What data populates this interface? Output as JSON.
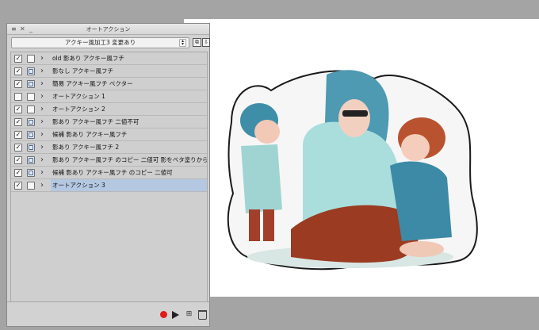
{
  "panel": {
    "title": "オートアクション",
    "set_name": "アクキー風加工3 変更あり",
    "items": [
      {
        "label": "old 影あり アクキー風フチ",
        "enabled": true,
        "dialog": false
      },
      {
        "label": "影なし アクキー風フチ",
        "enabled": true,
        "dialog": true
      },
      {
        "label": "簡易 アクキー風フチ ベクター",
        "enabled": true,
        "dialog": true
      },
      {
        "label": "オートアクション 1",
        "enabled": false,
        "dialog": false
      },
      {
        "label": "オートアクション 2",
        "enabled": true,
        "dialog": false
      },
      {
        "label": "影あり アクキー風フチ 二値不可",
        "enabled": true,
        "dialog": true
      },
      {
        "label": "候補 影あり アクキー風フチ",
        "enabled": true,
        "dialog": true
      },
      {
        "label": "影あり アクキー風フチ 2",
        "enabled": true,
        "dialog": true
      },
      {
        "label": "影あり アクキー風フチ のコピー 二値可 影をベタ塗りから",
        "enabled": true,
        "dialog": true
      },
      {
        "label": "候補 影あり アクキー風フチ のコピー 二値可",
        "enabled": true,
        "dialog": true
      },
      {
        "label": "オートアクション 3",
        "enabled": true,
        "dialog": false,
        "selected": true
      }
    ]
  },
  "icons": {
    "menu": "menu-icon",
    "close": "close-icon",
    "minimize": "minimize-icon",
    "new_set": "new-set-icon",
    "import": "import-icon",
    "record": "record-icon",
    "play": "play-icon",
    "add_action": "add-action-icon",
    "delete": "trash-icon"
  },
  "colors": {
    "record": "#e11a1a",
    "selection": "#b4c8e2",
    "canvas": "#ffffff",
    "background": "#a4a4a4"
  }
}
